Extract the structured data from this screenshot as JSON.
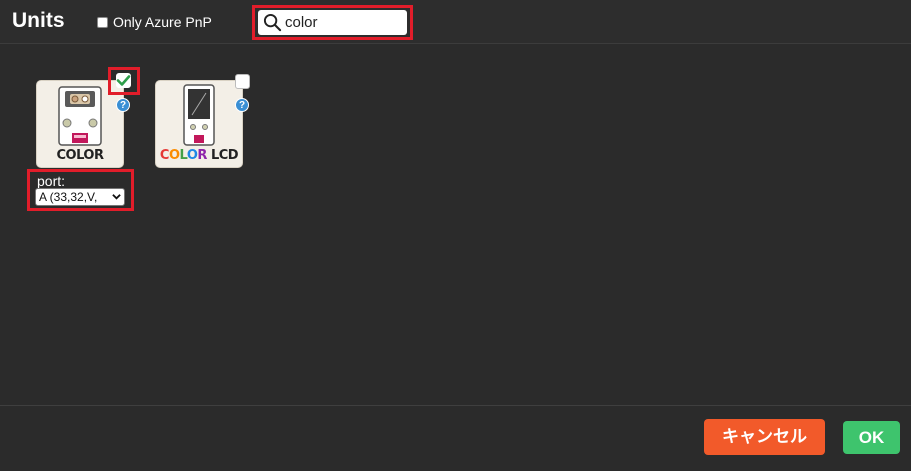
{
  "header": {
    "title": "Units",
    "only_azure_pnp_label": "Only Azure PnP",
    "only_azure_pnp_checked": false,
    "search": {
      "value": "color",
      "icon": "search-icon"
    }
  },
  "units": [
    {
      "name": "COLOR",
      "checked": true,
      "help": "?",
      "port_label": "port:",
      "port_value": "A (33,32,V,"
    },
    {
      "name_parts": [
        "C",
        "O",
        "L",
        "O",
        "R",
        " ",
        "LCD"
      ],
      "checked": false,
      "help": "?"
    }
  ],
  "lcd_colors": [
    "#e53935",
    "#fb8c00",
    "#43a047",
    "#1e88e5",
    "#8e24aa"
  ],
  "footer": {
    "cancel_label": "キャンセル",
    "ok_label": "OK"
  },
  "colors": {
    "cancel": "#f25a2a",
    "ok": "#3ec46d",
    "highlight": "#e11d2a",
    "check": "#2e9e4a"
  }
}
